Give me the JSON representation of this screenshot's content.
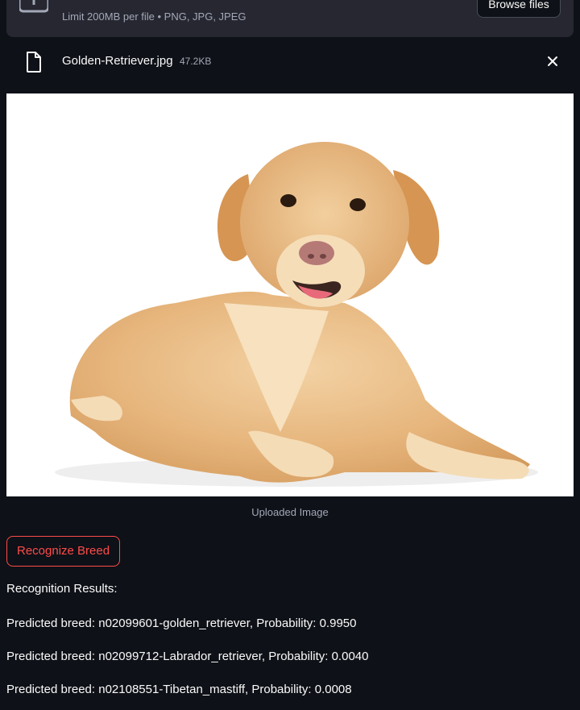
{
  "uploader": {
    "limit_text": "Limit 200MB per file • PNG, JPG, JPEG",
    "browse_label": "Browse files"
  },
  "file": {
    "name": "Golden-Retriever.jpg",
    "size": "47.2KB"
  },
  "image": {
    "caption": "Uploaded Image"
  },
  "actions": {
    "recognize_label": "Recognize Breed"
  },
  "results": {
    "heading": "Recognition Results:",
    "items": [
      "Predicted breed: n02099601-golden_retriever, Probability: 0.9950",
      "Predicted breed: n02099712-Labrador_retriever, Probability: 0.0040",
      "Predicted breed: n02108551-Tibetan_mastiff, Probability: 0.0008"
    ]
  },
  "colors": {
    "background": "#0e1117",
    "accent": "#ff4b4b",
    "panel": "#262730"
  }
}
